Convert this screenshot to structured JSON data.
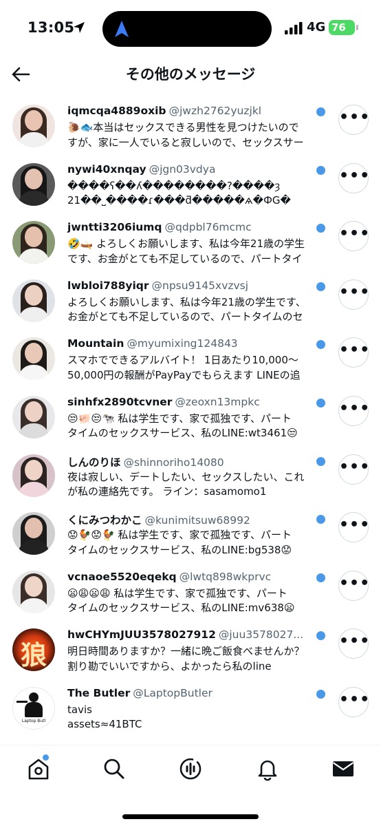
{
  "status_bar": {
    "time": "13:05",
    "network": "4G",
    "battery": "76"
  },
  "header": {
    "title": "その他のメッセージ"
  },
  "messages": [
    {
      "display_name": "iqmcqa4889oxib",
      "handle": "@jwzh2762yuzjkl",
      "line1": "🐌🐟本当はセックスできる男性を見つけたいので",
      "line2": "すが、家に一人でいると寂しいので、セックスサー",
      "unread": true,
      "avatar_colors": [
        "#efe4df",
        "#e9c4b3",
        "#3a2a22",
        "#f1f1f1"
      ]
    },
    {
      "display_name": "nywi40xnqay",
      "handle": "@jgn03vdya",
      "line1": "����ʕ��ʎ��������?����ȝ",
      "line2": "21��˽����ɾ���ƌ�����ѧ�ФG�",
      "unread": true,
      "avatar_colors": [
        "#5a5a5a",
        "#e3c2b1",
        "#161616",
        "#2a2a2a"
      ]
    },
    {
      "display_name": "jwntti3206iumq",
      "handle": "@qdpbl76mcmc",
      "line1": "🤣🛶 よろしくお願いします、私は今年21歳の学生",
      "line2": "です、お金がとても不足しているので、パートタイ",
      "unread": true,
      "avatar_colors": [
        "#8a9a74",
        "#e4c0ad",
        "#2d241e",
        "#f2f2ee"
      ]
    },
    {
      "display_name": "lwbloi788yiqr",
      "handle": "@npsu9145xvzvsj",
      "line1": "よろしくお願いします、私は今年21歳の学生です、",
      "line2": "お金がとても不足しているので、パートタイムのセ",
      "unread": true,
      "avatar_colors": [
        "#dfe3e8",
        "#ecd0c2",
        "#2a201c",
        "#efefef"
      ]
    },
    {
      "display_name": "Mountain",
      "handle": "@myumixing124843",
      "line1": "スマホでできるアルバイト！ 1日あたり10,000～",
      "line2": "50,000円の報酬がPayPayでもらえます LINEの追",
      "unread": true,
      "avatar_colors": [
        "#ebe7e2",
        "#e8c9b8",
        "#1e1a18",
        "#f6f6f6"
      ]
    },
    {
      "display_name": "sinhfx2890tcvner",
      "handle": "@zeoxn13mpkc",
      "line1": "😒🐖😒🐄 私は学生です、家で孤独です、パート",
      "line2": "タイムのセックスサービス、私のLINE:wt3461😒",
      "unread": true,
      "avatar_colors": [
        "#e8e8ea",
        "#ecd1c4",
        "#3a2e2a",
        "#dcdcdc"
      ]
    },
    {
      "display_name": "しんのりほ",
      "handle": "@shinnoriho14080",
      "line1": "夜は寂しい、デートしたい、セックスしたい、これ",
      "line2": "が私の連絡先です。 ライン：sasamomo1",
      "unread": true,
      "avatar_colors": [
        "#d8c2c9",
        "#efd3c6",
        "#2b2222",
        "#f0d6dc"
      ]
    },
    {
      "display_name": "くにみつわかこ",
      "handle": "@kunimitsuw68992",
      "line1": "😟🐓😟🐓 私は学生です、家で孤独です、パート",
      "line2": "タイムのセックスサービス、私のLINE:bg538😟",
      "unread": true,
      "avatar_colors": [
        "#cfcfcf",
        "#e2bfae",
        "#1c1c1c",
        "#222222"
      ]
    },
    {
      "display_name": "vcnaoe5520eqekq",
      "handle": "@lwtq898wkprvc",
      "line1": "😦😩😦😩 私は学生です、家で孤独です、パート",
      "line2": "タイムのセックスサービス、私のLINE:mv638😦",
      "unread": true,
      "avatar_colors": [
        "#e6e6e6",
        "#efd4c8",
        "#3b2d28",
        "#f4f4f4"
      ]
    },
    {
      "display_name": "hwCHYmJUU3578027912",
      "handle": "@juu3578027...",
      "line1": "明日時間ありますか？一緒に晩ご飯食べませんか？",
      "line2": "割り勘でいいですから、よかったら私のline",
      "unread": true,
      "avatar_colors": [
        "#1a0a04",
        "#d13a12",
        "#ff6a1a",
        "#3a1004"
      ],
      "avatar_char": "狼"
    },
    {
      "display_name": "The Butler",
      "handle": "@LaptopButler",
      "line1": "tavis",
      "line2": "assets≈41BTC",
      "unread": true,
      "avatar_colors": [
        "#ffffff",
        "#ffffff",
        "#111111",
        "#111111"
      ],
      "avatar_caption": "Laptop Butl"
    }
  ],
  "more_label": "•••",
  "tabs": [
    {
      "name": "home",
      "notification": true
    },
    {
      "name": "search"
    },
    {
      "name": "spaces"
    },
    {
      "name": "notifications"
    },
    {
      "name": "messages"
    }
  ]
}
